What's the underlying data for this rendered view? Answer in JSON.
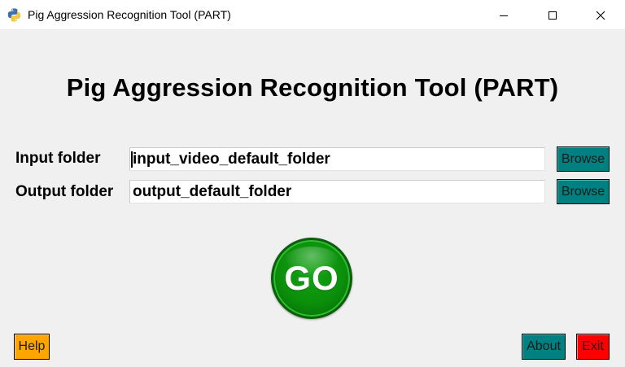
{
  "window": {
    "title": "Pig Aggression Recognition Tool (PART)",
    "icon": "python-icon"
  },
  "heading": "Pig Aggression Recognition Tool (PART)",
  "fields": {
    "input_label": "Input folder",
    "input_value": "input_video_default_folder",
    "output_label": "Output folder",
    "output_value": "output_default_folder",
    "browse_label": "Browse"
  },
  "go_label": "GO",
  "bottom": {
    "help_label": "Help",
    "about_label": "About",
    "exit_label": "Exit"
  },
  "colors": {
    "background": "#f0f0f0",
    "browse": "#008080",
    "about": "#008080",
    "help": "#ffa500",
    "exit": "#ff0000",
    "go": "#0b8f0b"
  }
}
